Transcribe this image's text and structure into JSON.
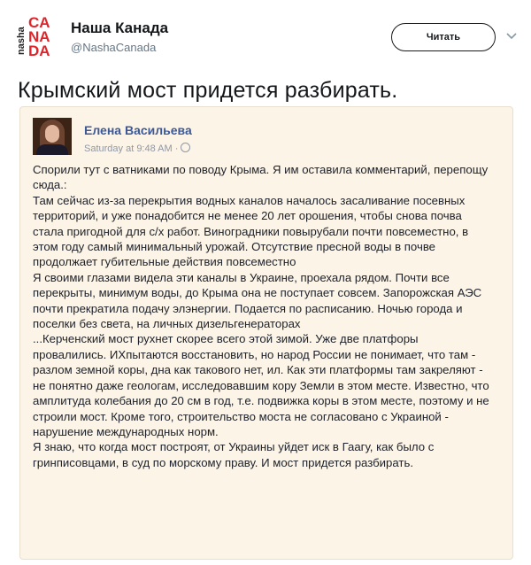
{
  "tweet": {
    "logo_text": {
      "side": "nasha",
      "line1": "CA",
      "line2": "NA",
      "line3": "DA"
    },
    "display_name": "Наша Канада",
    "handle": "@NashaCanada",
    "follow_label": "Читать",
    "text": "Крымский мост придется разбирать."
  },
  "post": {
    "author": "Елена Васильева",
    "timestamp": "Saturday at 9:48 AM ·",
    "paragraphs": [
      "Спорили тут с ватниками по поводу Крыма. Я им оставила комментарий, перепощу сюда.:",
      " Там сейчас из-за перекрытия водных каналов началось засаливание посевных территорий, и уже понадобится не менее 20 лет орошения, чтобы снова почва стала пригодной для с/х работ. Виноградники повырубали почти повсеместно, в этом году самый минимальный урожай. Отсутствие пресной воды в почве продолжает губительные действия повсеместно",
      "Я своими глазами видела эти каналы в Украине, проехала рядом. Почти все перекрыты, минимум воды, до Крыма она не поступает совсем. Запорожская АЭС почти прекратила подачу элэнергии. Подается по расписанию. Ночью города и поселки без света, на личных дизельгенераторах",
      "...Керченский мост рухнет скорее всего этой зимой. Уже две платфоры провалились. ИХпытаются восстановить, но народ России не понимает, что там - разлом земной коры, дна как такового нет, ил. Как эти платформы там закреляют - не понятно даже геологам, исследовавшим кору Земли в этом месте. Известно, что амплитуда колебания до 20 см в год, т.е. подвижка коры в этом месте, поэтому и не строили мост. Кроме того, строительство моста не согласовано с Украиной - нарушение международных норм.",
      "Я знаю, что когда мост построят, от Украины уйдет иск в Гаагу, как было с гринписовцами, в суд по морскому праву. И мост придется разбирать."
    ]
  },
  "colors": {
    "card_bg": "#fcf4e7",
    "author_link": "#3b5998",
    "logo_red": "#e0242a"
  },
  "icons": [
    "chevron-down-icon",
    "globe-icon"
  ]
}
